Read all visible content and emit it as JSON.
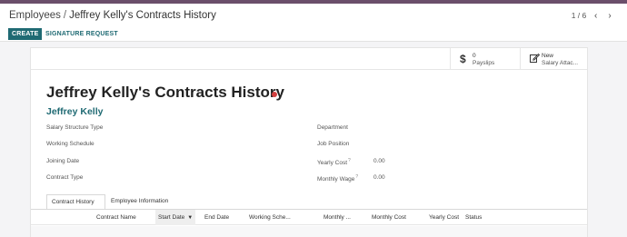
{
  "breadcrumb": {
    "parent": "Employees",
    "separator": "/",
    "current": "Jeffrey Kelly's Contracts History"
  },
  "pager": {
    "value": "1 / 6",
    "prev_icon": "chevron-left-icon",
    "next_icon": "chevron-right-icon"
  },
  "toolbar": {
    "create_label": "CREATE",
    "signature_label": "SIGNATURE REQUEST"
  },
  "stats": [
    {
      "icon": "dollar-icon",
      "value": "0",
      "label": "Payslips"
    },
    {
      "icon": "edit-document-icon",
      "value": "New",
      "label": "Salary Attac..."
    }
  ],
  "form": {
    "title": "Jeffrey Kelly's Contracts History",
    "status_color": "#d23f3f",
    "employee_name": "Jeffrey Kelly",
    "left_fields": [
      {
        "label": "Salary Structure Type"
      },
      {
        "label": "Working Schedule"
      },
      {
        "label": "Joining Date"
      },
      {
        "label": "Contract Type"
      }
    ],
    "right_fields": [
      {
        "label": "Department",
        "value": ""
      },
      {
        "label": "Job Position",
        "value": ""
      },
      {
        "label": "Yearly Cost",
        "help": "?",
        "value": "0.00"
      },
      {
        "label": "Monthly Wage",
        "help": "?",
        "value": "0.00"
      }
    ]
  },
  "tabs": [
    {
      "label": "Contract History",
      "active": true
    },
    {
      "label": "Employee Information",
      "active": false
    }
  ],
  "table": {
    "columns": [
      "Contract Name",
      "Start Date",
      "End Date",
      "Working Sche...",
      "Monthly ...",
      "Monthly Cost",
      "Yearly Cost",
      "Status"
    ],
    "sorted_column": "Start Date"
  },
  "colors": {
    "brand": "#6b4f6b",
    "primary": "#1f6a73",
    "accent_text": "#1f6a73"
  }
}
